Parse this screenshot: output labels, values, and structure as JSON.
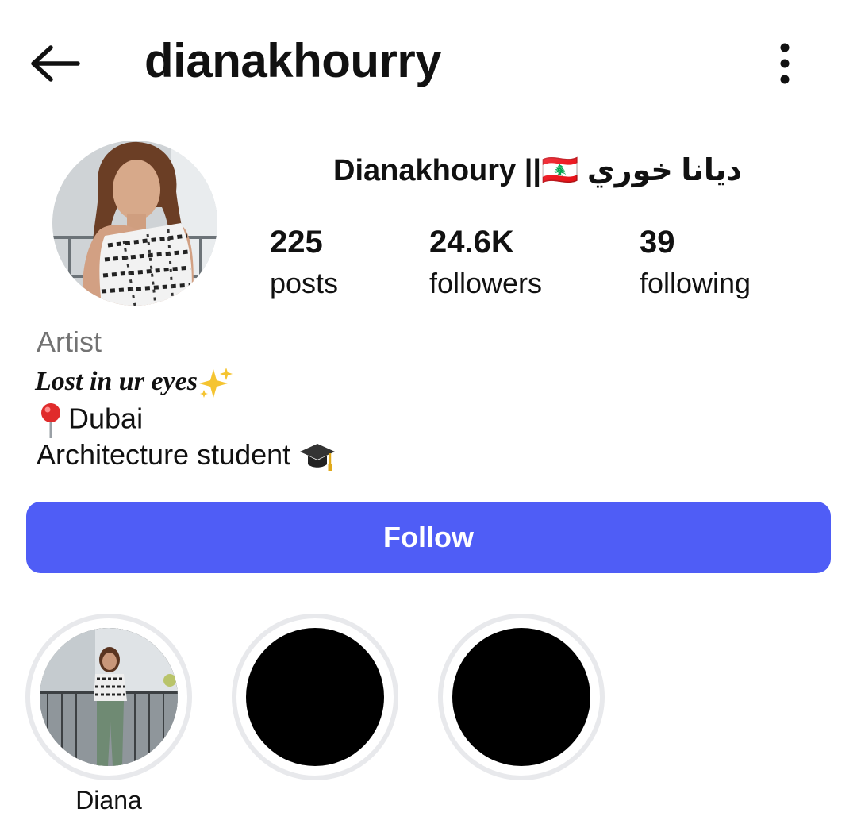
{
  "header": {
    "username": "dianakhourry"
  },
  "profile": {
    "display_name": "Dianakhoury ||🇱🇧 ديانا خوري",
    "stats": [
      {
        "value": "225",
        "label": "posts"
      },
      {
        "value": "24.6K",
        "label": "followers"
      },
      {
        "value": "39",
        "label": "following"
      }
    ],
    "category": "Artist",
    "bio": {
      "line1": "Lost in ur eyes",
      "line2": "Dubai",
      "line3": "Architecture student "
    },
    "follow_label": "Follow"
  },
  "highlights": [
    {
      "label": "Diana"
    },
    {
      "label": ""
    },
    {
      "label": ""
    }
  ],
  "colors": {
    "accent": "#4f5df6",
    "category_text": "#737373",
    "highlight_ring": "#e8e9ec"
  },
  "icons": {
    "back": "arrow-left-icon",
    "more": "vertical-ellipsis-icon",
    "flag": "lebanon-flag-icon",
    "sparkles": "sparkles-icon",
    "pin": "round-pushpin-icon",
    "cap": "graduation-cap-icon"
  }
}
